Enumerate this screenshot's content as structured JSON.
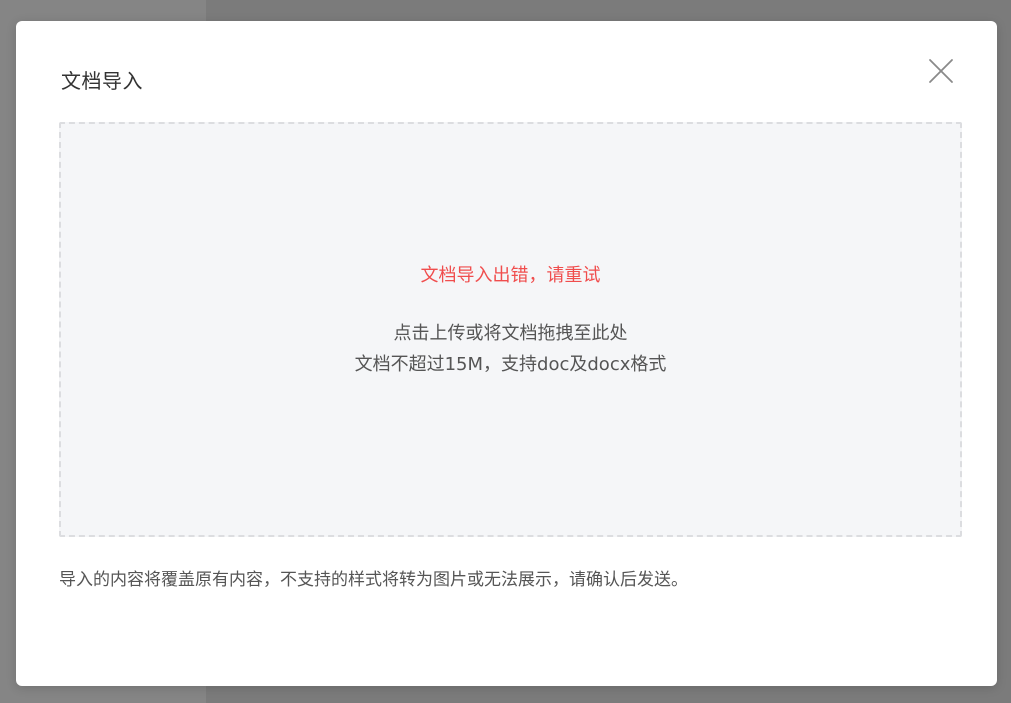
{
  "dialog": {
    "title": "文档导入",
    "close_icon": "close-icon"
  },
  "dropzone": {
    "error_text": "文档导入出错，请重试",
    "hint_line1": "点击上传或将文档拖拽至此处",
    "hint_line2": "文档不超过15M，支持doc及docx格式"
  },
  "notice": {
    "text": "导入的内容将覆盖原有内容，不支持的样式将转为图片或无法展示，请确认后发送。"
  },
  "colors": {
    "error": "#f04d4d",
    "dropzone_bg": "#f5f6f8",
    "overlay": "#7f7f7f"
  }
}
